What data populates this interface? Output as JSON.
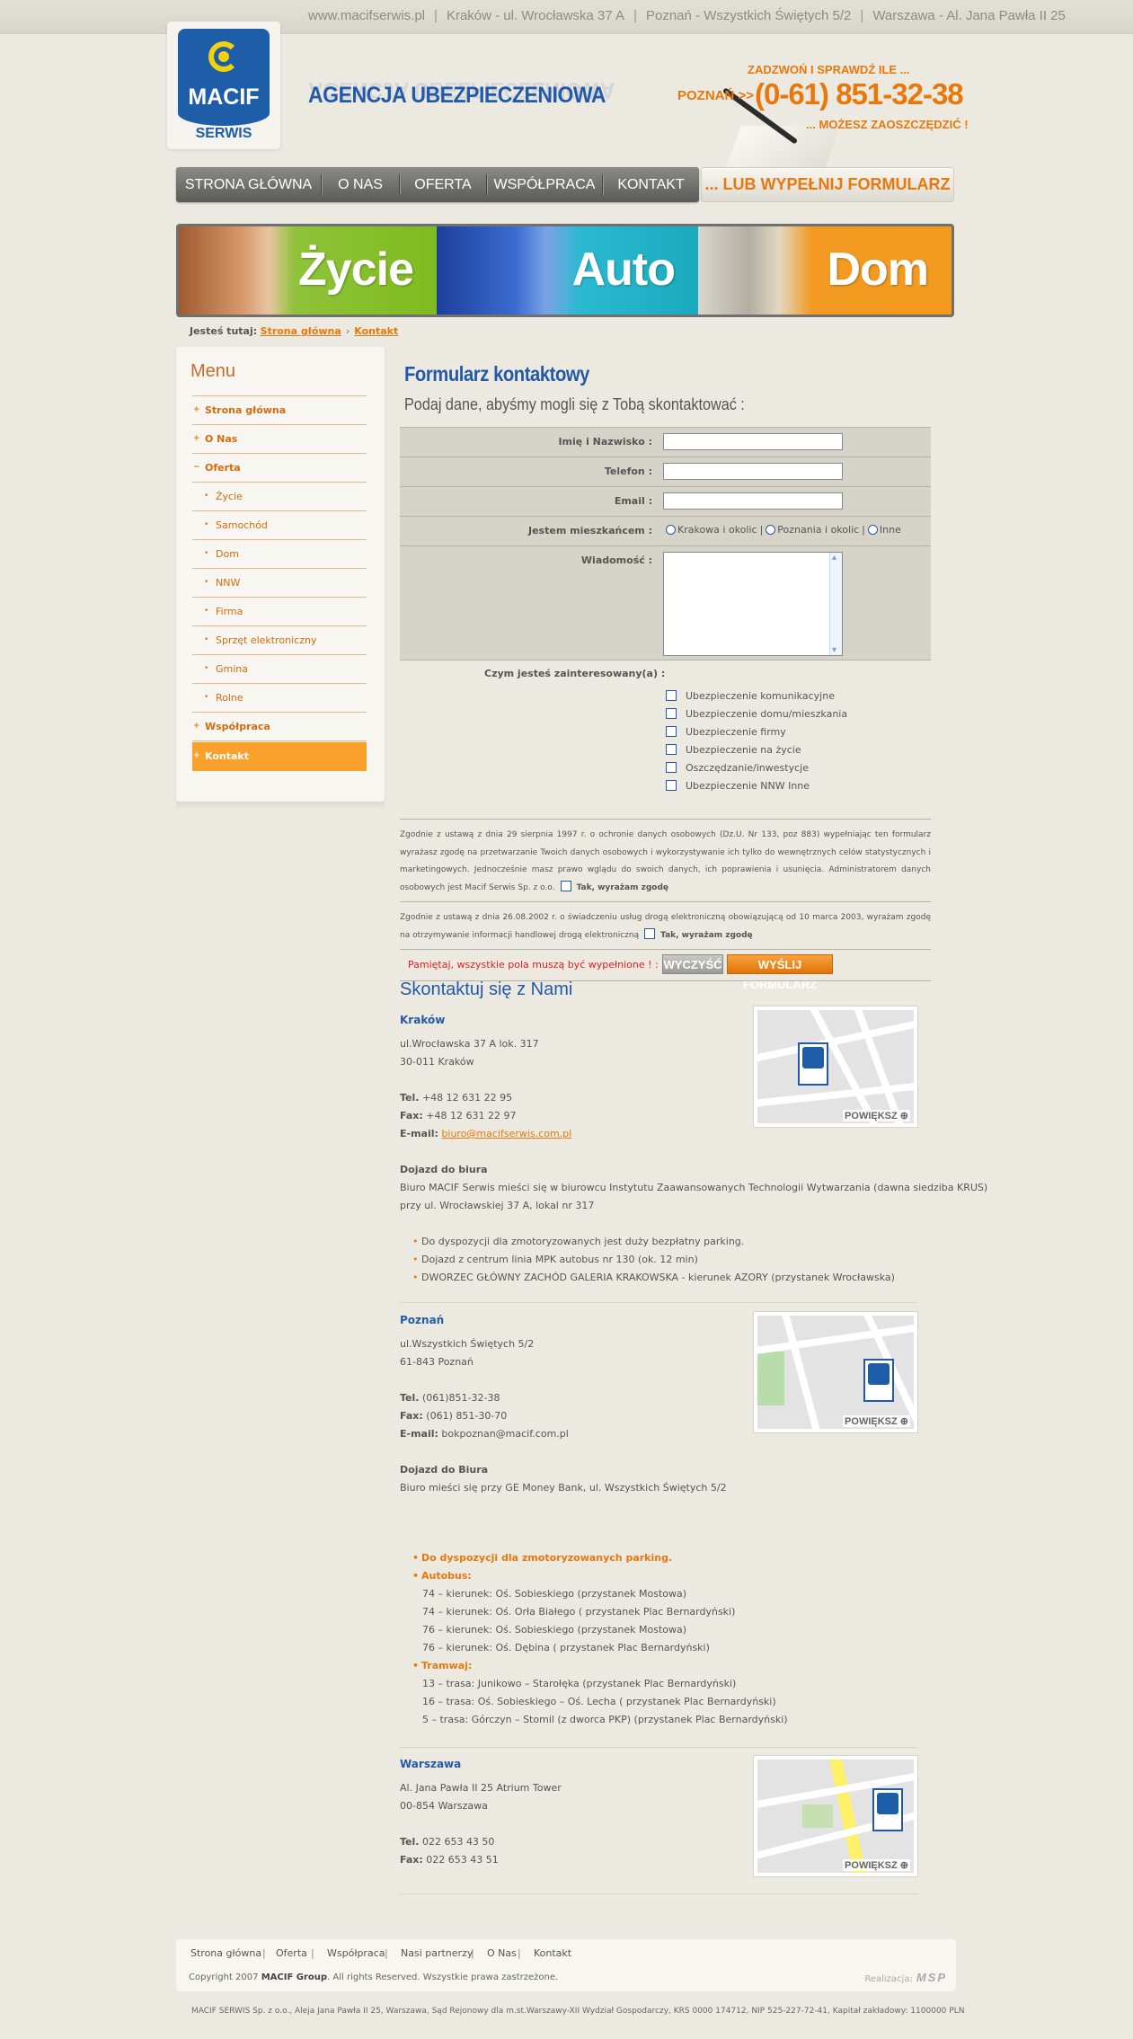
{
  "topbar": {
    "items": [
      "www.macifserwis.pl",
      "Kraków - ul. Wrocławska 37 A",
      "Poznań - Wszystkich Świętych 5/2",
      "Warszawa - Al. Jana Pawła II 25"
    ]
  },
  "header": {
    "logo_text": "MACIF",
    "logo_sub": "SERWIS",
    "agency": "AGENCJA UBEZPIECZENIOWA",
    "call_line": "ZADZWOŃ I SPRAWDŹ ILE ...",
    "city": "POZNAŃ  >>",
    "phone": "(0-61) 851-32-38",
    "save_line": "... MOŻESZ ZAOSZCZĘDZIĆ !",
    "form_button": "... LUB WYPEŁNIJ FORMULARZ"
  },
  "nav": [
    "STRONA GŁÓWNA",
    "O NAS",
    "OFERTA",
    "WSPÓŁPRACA",
    "KONTAKT"
  ],
  "banner": [
    "Życie",
    "Auto",
    "Dom"
  ],
  "breadcrumb": {
    "label": "Jesteś tutaj:",
    "home": "Strona główna",
    "current": "Kontakt"
  },
  "sidebar": {
    "title": "Menu",
    "items": [
      {
        "label": "Strona główna",
        "level": 0
      },
      {
        "label": "O Nas",
        "level": 0
      },
      {
        "label": "Oferta",
        "level": 0
      },
      {
        "label": "Życie",
        "level": 1
      },
      {
        "label": "Samochód",
        "level": 1
      },
      {
        "label": "Dom",
        "level": 1
      },
      {
        "label": "NNW",
        "level": 1
      },
      {
        "label": "Firma",
        "level": 1
      },
      {
        "label": "Sprzęt elektroniczny",
        "level": 1
      },
      {
        "label": "Gmina",
        "level": 1
      },
      {
        "label": "Rolne",
        "level": 1
      },
      {
        "label": "Współpraca",
        "level": 0
      },
      {
        "label": "Kontakt",
        "level": 0,
        "active": true
      }
    ]
  },
  "form": {
    "title": "Formularz kontaktowy",
    "subtitle": "Podaj dane, abyśmy mogli się z Tobą skontaktować :",
    "name_label": "Imię i Nazwisko :",
    "phone_label": "Telefon :",
    "email_label": "Email :",
    "resident_label": "Jestem mieszkańcem :",
    "radios": [
      "Krakowa i okolic",
      "Poznania i okolic",
      "Inne"
    ],
    "message_label": "Wiadomość :",
    "interest_label": "Czym jesteś zainteresowany(a) :",
    "checkboxes": [
      "Ubezpieczenie komunikacyjne",
      "Ubezpieczenie domu/mieszkania",
      "Ubezpieczenie firmy",
      "Ubezpieczenie na życie",
      "Oszczędzanie/inwestycje",
      "Ubezpieczenie NNW Inne"
    ],
    "consent1_text": "Zgodnie z ustawą z dnia 29 sierpnia 1997 r. o ochronie danych osobowych (Dz.U. Nr 133, poz 883) wypełniając ten formularz wyrażasz zgodę na przetwarzanie Twoich danych osobowych i wykorzystywanie ich tylko do wewnętrznych celów statystycznych i marketingowych. Jednocześnie masz prawo wglądu do swoich danych, ich poprawienia i usunięcia. Administratorem danych osobowych jest Macif Serwis Sp. z o.o.",
    "consent_label": "Tak, wyrażam zgodę",
    "consent2_text": "Zgodnie z ustawą z dnia 26.08.2002 r. o świadczeniu usług drogą elektroniczną obowiązującą od 10 marca 2003, wyrażam zgodę na otrzymywanie informacji handlowej drogą elektroniczną",
    "required_note": "Pamiętaj, wszystkie pola muszą być wypełnione ! :",
    "clear_button": "WYCZYŚĆ",
    "send_button": "WYŚLIJ FORMULARZ"
  },
  "contact": {
    "title": "Skontaktuj się z Nami",
    "zoom": "POWIĘKSZ",
    "krakow": {
      "city": "Kraków",
      "addr1": "ul.Wrocławska 37 A lok. 317",
      "addr2": "30-011 Kraków",
      "tel_label": "Tel.",
      "tel": "+48 12 631 22 95",
      "fax_label": "Fax:",
      "fax": "+48 12 631 22 97",
      "email_label": "E-mail:",
      "email": "biuro@macifserwis.com.pl",
      "dojazd_title": "Dojazd do biura",
      "dojazd1": "Biuro MACIF Serwis mieści się w biurowcu Instytutu Zaawansowanych Technologii Wytwarzania (dawna siedziba KRUS)",
      "dojazd2": "przy ul. Wrocławskiej 37 A, lokal nr 317",
      "bullets": [
        "Do dyspozycji dla zmotoryzowanych jest duży bezpłatny parking.",
        "Dojazd z centrum linia MPK autobus nr 130 (ok. 12 min)",
        "DWORZEC GŁÓWNY ZACHÓD GALERIA KRAKOWSKA - kierunek AZORY (przystanek Wrocławska)"
      ]
    },
    "poznan": {
      "city": "Poznań",
      "addr1": "ul.Wszystkich Świętych 5/2",
      "addr2": "61-843 Poznań",
      "tel_label": "Tel.",
      "tel": "(061)851-32-38",
      "fax_label": "Fax:",
      "fax": "(061) 851-30-70",
      "email_label": "E-mail:",
      "email": "bokpoznan@macif.com.pl",
      "dojazd_title": "Dojazd do Biura",
      "dojazd1": "Biuro mieści się przy GE Money Bank, ul. Wszystkich Świętych 5/2",
      "parking": "Do dyspozycji dla zmotoryzowanych parking.",
      "bus_label": "Autobus:",
      "bus": [
        "74 – kierunek: Oś. Sobieskiego (przystanek Mostowa)",
        "74 – kierunek: Oś. Orła Białego ( przystanek Plac Bernardyński)",
        "76 – kierunek: Oś. Sobieskiego (przystanek Mostowa)",
        "76 – kierunek: Oś. Dębina ( przystanek Plac Bernardyński)"
      ],
      "tram_label": "Tramwaj:",
      "tram": [
        "13 – trasa: Junikowo – Starołęka (przystanek Plac Bernardyński)",
        "16 – trasa: Oś. Sobieskiego – Oś. Lecha ( przystanek Plac Bernardyński)",
        "5 – trasa: Górczyn – Stomil (z dworca PKP) (przystanek Plac Bernardyński)"
      ]
    },
    "warszawa": {
      "city": "Warszawa",
      "addr1": "Al. Jana Pawła II 25 Atrium Tower",
      "addr2": "00-854 Warszawa",
      "tel_label": "Tel.",
      "tel": "022 653 43 50",
      "fax_label": "Fax:",
      "fax": "022 653 43 51"
    }
  },
  "footer": {
    "links": [
      "Strona główna",
      "Oferta",
      "Współpraca",
      "Nasi partnerzy",
      "O Nas",
      "Kontakt"
    ],
    "copyright_pre": "Copyright 2007",
    "copyright_brand": "MACIF Group",
    "copyright_post": ". All rights Reserved. Wszystkie prawa zastrzeżone.",
    "realizacja": "Realizacja:",
    "realizacja_brand": "MSP",
    "legal": "MACIF SERWIS Sp. z o.o., Aleja Jana Pawła II 25, Warszawa, Sąd Rejonowy dla m.st.Warszawy-XII Wydział Gospodarczy, KRS 0000 174712, NIP 525-227-72-41, Kapitał zakładowy: 1100000 PLN"
  },
  "colors": {
    "accent": "#e8780c",
    "brand_blue": "#2359a8",
    "active_menu": "#fba12b",
    "background": "#eceae0"
  }
}
